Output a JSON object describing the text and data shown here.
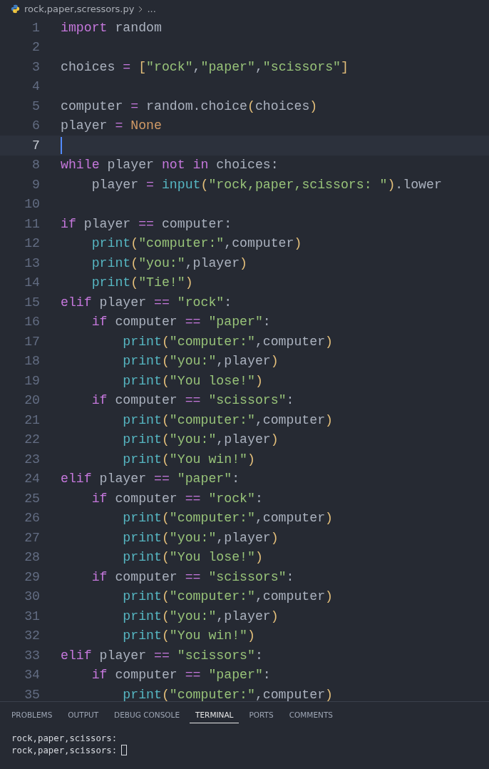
{
  "breadcrumb": {
    "file": "rock,paper,scressors.py",
    "more": "..."
  },
  "editor": {
    "lines": [
      {
        "number": "1",
        "current": false,
        "tokens": [
          {
            "kind": "keyword",
            "text": "import"
          },
          {
            "kind": "plain",
            "text": " random"
          }
        ]
      },
      {
        "number": "2",
        "current": false
      },
      {
        "number": "3",
        "current": false,
        "tokens": [
          {
            "kind": "plain",
            "text": "choices "
          },
          {
            "kind": "operator",
            "text": "= "
          },
          {
            "kind": "bracket",
            "text": "["
          },
          {
            "kind": "string",
            "text": "\"rock\""
          },
          {
            "kind": "plain",
            "text": ","
          },
          {
            "kind": "string",
            "text": "\"paper\""
          },
          {
            "kind": "plain",
            "text": ","
          },
          {
            "kind": "string",
            "text": "\"scissors\""
          },
          {
            "kind": "bracket",
            "text": "]"
          }
        ]
      },
      {
        "number": "4",
        "current": false
      },
      {
        "number": "5",
        "current": false,
        "tokens": [
          {
            "kind": "plain",
            "text": "computer "
          },
          {
            "kind": "operator",
            "text": "="
          },
          {
            "kind": "plain",
            "text": " random.choice"
          },
          {
            "kind": "bracket",
            "text": "("
          },
          {
            "kind": "plain",
            "text": "choices"
          },
          {
            "kind": "bracket",
            "text": ")"
          }
        ]
      },
      {
        "number": "6",
        "current": false,
        "tokens": [
          {
            "kind": "plain",
            "text": "player "
          },
          {
            "kind": "operator",
            "text": "= "
          },
          {
            "kind": "constant",
            "text": "None"
          }
        ]
      },
      {
        "number": "7",
        "current": true
      },
      {
        "number": "8",
        "current": false,
        "tokens": [
          {
            "kind": "keyword",
            "text": "while"
          },
          {
            "kind": "plain",
            "text": " player "
          },
          {
            "kind": "keyword",
            "text": "not in"
          },
          {
            "kind": "plain",
            "text": " choices:"
          }
        ]
      },
      {
        "number": "9",
        "current": false,
        "tokens": [
          {
            "kind": "plain",
            "text": "    player "
          },
          {
            "kind": "operator",
            "text": "= "
          },
          {
            "kind": "function",
            "text": "input"
          },
          {
            "kind": "bracket",
            "text": "("
          },
          {
            "kind": "string",
            "text": "\"rock,paper,scissors: \""
          },
          {
            "kind": "bracket",
            "text": ")"
          },
          {
            "kind": "plain",
            "text": ".lower"
          }
        ]
      },
      {
        "number": "10",
        "current": false
      },
      {
        "number": "11",
        "current": false,
        "tokens": [
          {
            "kind": "keyword",
            "text": "if"
          },
          {
            "kind": "plain",
            "text": " player "
          },
          {
            "kind": "operator",
            "text": "=="
          },
          {
            "kind": "plain",
            "text": " computer:"
          }
        ]
      },
      {
        "number": "12",
        "current": false,
        "tokens": [
          {
            "kind": "function",
            "text": "    print"
          },
          {
            "kind": "bracket",
            "text": "("
          },
          {
            "kind": "string",
            "text": "\"computer:\""
          },
          {
            "kind": "plain",
            "text": ",computer"
          },
          {
            "kind": "bracket",
            "text": ")"
          }
        ]
      },
      {
        "number": "13",
        "current": false,
        "tokens": [
          {
            "kind": "function",
            "text": "    print"
          },
          {
            "kind": "bracket",
            "text": "("
          },
          {
            "kind": "string",
            "text": "\"you:\""
          },
          {
            "kind": "plain",
            "text": ",player"
          },
          {
            "kind": "bracket",
            "text": ")"
          }
        ]
      },
      {
        "number": "14",
        "current": false,
        "tokens": [
          {
            "kind": "function",
            "text": "    print"
          },
          {
            "kind": "bracket",
            "text": "("
          },
          {
            "kind": "string",
            "text": "\"Tie!\""
          },
          {
            "kind": "bracket",
            "text": ")"
          }
        ]
      },
      {
        "number": "15",
        "current": false,
        "tokens": [
          {
            "kind": "keyword",
            "text": "elif"
          },
          {
            "kind": "plain",
            "text": " player "
          },
          {
            "kind": "operator",
            "text": "== "
          },
          {
            "kind": "string",
            "text": "\"rock\""
          },
          {
            "kind": "plain",
            "text": ":"
          }
        ]
      },
      {
        "number": "16",
        "current": false,
        "tokens": [
          {
            "kind": "keyword",
            "text": "    if"
          },
          {
            "kind": "plain",
            "text": " computer "
          },
          {
            "kind": "operator",
            "text": "== "
          },
          {
            "kind": "string",
            "text": "\"paper\""
          },
          {
            "kind": "plain",
            "text": ":"
          }
        ]
      },
      {
        "number": "17",
        "current": false,
        "tokens": [
          {
            "kind": "function",
            "text": "        print"
          },
          {
            "kind": "bracket",
            "text": "("
          },
          {
            "kind": "string",
            "text": "\"computer:\""
          },
          {
            "kind": "plain",
            "text": ",computer"
          },
          {
            "kind": "bracket",
            "text": ")"
          }
        ]
      },
      {
        "number": "18",
        "current": false,
        "tokens": [
          {
            "kind": "function",
            "text": "        print"
          },
          {
            "kind": "bracket",
            "text": "("
          },
          {
            "kind": "string",
            "text": "\"you:\""
          },
          {
            "kind": "plain",
            "text": ",player"
          },
          {
            "kind": "bracket",
            "text": ")"
          }
        ]
      },
      {
        "number": "19",
        "current": false,
        "tokens": [
          {
            "kind": "function",
            "text": "        print"
          },
          {
            "kind": "bracket",
            "text": "("
          },
          {
            "kind": "string",
            "text": "\"You lose!\""
          },
          {
            "kind": "bracket",
            "text": ")"
          }
        ]
      },
      {
        "number": "20",
        "current": false,
        "tokens": [
          {
            "kind": "keyword",
            "text": "    if"
          },
          {
            "kind": "plain",
            "text": " computer "
          },
          {
            "kind": "operator",
            "text": "== "
          },
          {
            "kind": "string",
            "text": "\"scissors\""
          },
          {
            "kind": "plain",
            "text": ":"
          }
        ]
      },
      {
        "number": "21",
        "current": false,
        "tokens": [
          {
            "kind": "function",
            "text": "        print"
          },
          {
            "kind": "bracket",
            "text": "("
          },
          {
            "kind": "string",
            "text": "\"computer:\""
          },
          {
            "kind": "plain",
            "text": ",computer"
          },
          {
            "kind": "bracket",
            "text": ")"
          }
        ]
      },
      {
        "number": "22",
        "current": false,
        "tokens": [
          {
            "kind": "function",
            "text": "        print"
          },
          {
            "kind": "bracket",
            "text": "("
          },
          {
            "kind": "string",
            "text": "\"you:\""
          },
          {
            "kind": "plain",
            "text": ",player"
          },
          {
            "kind": "bracket",
            "text": ")"
          }
        ]
      },
      {
        "number": "23",
        "current": false,
        "tokens": [
          {
            "kind": "function",
            "text": "        print"
          },
          {
            "kind": "bracket",
            "text": "("
          },
          {
            "kind": "string",
            "text": "\"You win!\""
          },
          {
            "kind": "bracket",
            "text": ")"
          }
        ]
      },
      {
        "number": "24",
        "current": false,
        "tokens": [
          {
            "kind": "keyword",
            "text": "elif"
          },
          {
            "kind": "plain",
            "text": " player "
          },
          {
            "kind": "operator",
            "text": "== "
          },
          {
            "kind": "string",
            "text": "\"paper\""
          },
          {
            "kind": "plain",
            "text": ":"
          }
        ]
      },
      {
        "number": "25",
        "current": false,
        "tokens": [
          {
            "kind": "keyword",
            "text": "    if"
          },
          {
            "kind": "plain",
            "text": " computer "
          },
          {
            "kind": "operator",
            "text": "== "
          },
          {
            "kind": "string",
            "text": "\"rock\""
          },
          {
            "kind": "plain",
            "text": ":"
          }
        ]
      },
      {
        "number": "26",
        "current": false,
        "tokens": [
          {
            "kind": "function",
            "text": "        print"
          },
          {
            "kind": "bracket",
            "text": "("
          },
          {
            "kind": "string",
            "text": "\"computer:\""
          },
          {
            "kind": "plain",
            "text": ",computer"
          },
          {
            "kind": "bracket",
            "text": ")"
          }
        ]
      },
      {
        "number": "27",
        "current": false,
        "tokens": [
          {
            "kind": "function",
            "text": "        print"
          },
          {
            "kind": "bracket",
            "text": "("
          },
          {
            "kind": "string",
            "text": "\"you:\""
          },
          {
            "kind": "plain",
            "text": ",player"
          },
          {
            "kind": "bracket",
            "text": ")"
          }
        ]
      },
      {
        "number": "28",
        "current": false,
        "tokens": [
          {
            "kind": "function",
            "text": "        print"
          },
          {
            "kind": "bracket",
            "text": "("
          },
          {
            "kind": "string",
            "text": "\"You lose!\""
          },
          {
            "kind": "bracket",
            "text": ")"
          }
        ]
      },
      {
        "number": "29",
        "current": false,
        "tokens": [
          {
            "kind": "keyword",
            "text": "    if"
          },
          {
            "kind": "plain",
            "text": " computer "
          },
          {
            "kind": "operator",
            "text": "== "
          },
          {
            "kind": "string",
            "text": "\"scissors\""
          },
          {
            "kind": "plain",
            "text": ":"
          }
        ]
      },
      {
        "number": "30",
        "current": false,
        "tokens": [
          {
            "kind": "function",
            "text": "        print"
          },
          {
            "kind": "bracket",
            "text": "("
          },
          {
            "kind": "string",
            "text": "\"computer:\""
          },
          {
            "kind": "plain",
            "text": ",computer"
          },
          {
            "kind": "bracket",
            "text": ")"
          }
        ]
      },
      {
        "number": "31",
        "current": false,
        "tokens": [
          {
            "kind": "function",
            "text": "        print"
          },
          {
            "kind": "bracket",
            "text": "("
          },
          {
            "kind": "string",
            "text": "\"you:\""
          },
          {
            "kind": "plain",
            "text": ",player"
          },
          {
            "kind": "bracket",
            "text": ")"
          }
        ]
      },
      {
        "number": "32",
        "current": false,
        "tokens": [
          {
            "kind": "function",
            "text": "        print"
          },
          {
            "kind": "bracket",
            "text": "("
          },
          {
            "kind": "string",
            "text": "\"You win!\""
          },
          {
            "kind": "bracket",
            "text": ")"
          }
        ]
      },
      {
        "number": "33",
        "current": false,
        "tokens": [
          {
            "kind": "keyword",
            "text": "elif"
          },
          {
            "kind": "plain",
            "text": " player "
          },
          {
            "kind": "operator",
            "text": "== "
          },
          {
            "kind": "string",
            "text": "\"scissors\""
          },
          {
            "kind": "plain",
            "text": ":"
          }
        ]
      },
      {
        "number": "34",
        "current": false,
        "tokens": [
          {
            "kind": "keyword",
            "text": "    if"
          },
          {
            "kind": "plain",
            "text": " computer "
          },
          {
            "kind": "operator",
            "text": "== "
          },
          {
            "kind": "string",
            "text": "\"paper\""
          },
          {
            "kind": "plain",
            "text": ":"
          }
        ]
      },
      {
        "number": "35",
        "current": false,
        "tokens": [
          {
            "kind": "function",
            "text": "        print"
          },
          {
            "kind": "bracket",
            "text": "("
          },
          {
            "kind": "string",
            "text": "\"computer:\""
          },
          {
            "kind": "plain",
            "text": ",computer"
          },
          {
            "kind": "bracket",
            "text": ")"
          }
        ]
      }
    ]
  },
  "panel": {
    "tabs": [
      {
        "label": "PROBLEMS",
        "selected": false
      },
      {
        "label": "OUTPUT",
        "selected": false
      },
      {
        "label": "DEBUG CONSOLE",
        "selected": false
      },
      {
        "label": "TERMINAL",
        "selected": true
      },
      {
        "label": "PORTS",
        "selected": false
      },
      {
        "label": "COMMENTS",
        "selected": false
      }
    ],
    "terminal": {
      "lines": [
        "rock,paper,scissors:",
        "rock,paper,scissors:"
      ]
    }
  }
}
